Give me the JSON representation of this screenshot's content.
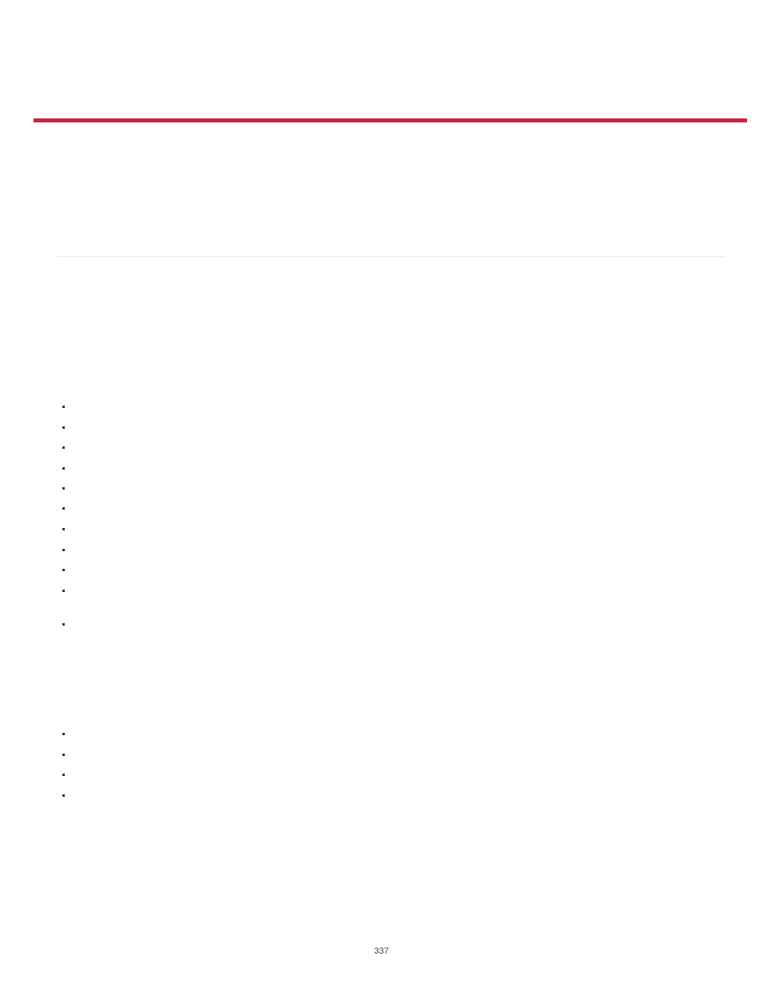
{
  "page_number": "337",
  "bullet_positions_group1": [
    507,
    533,
    558,
    584,
    609,
    634,
    660,
    686,
    711,
    737,
    779
  ],
  "bullet_positions_group2": [
    916,
    942,
    967,
    993
  ]
}
